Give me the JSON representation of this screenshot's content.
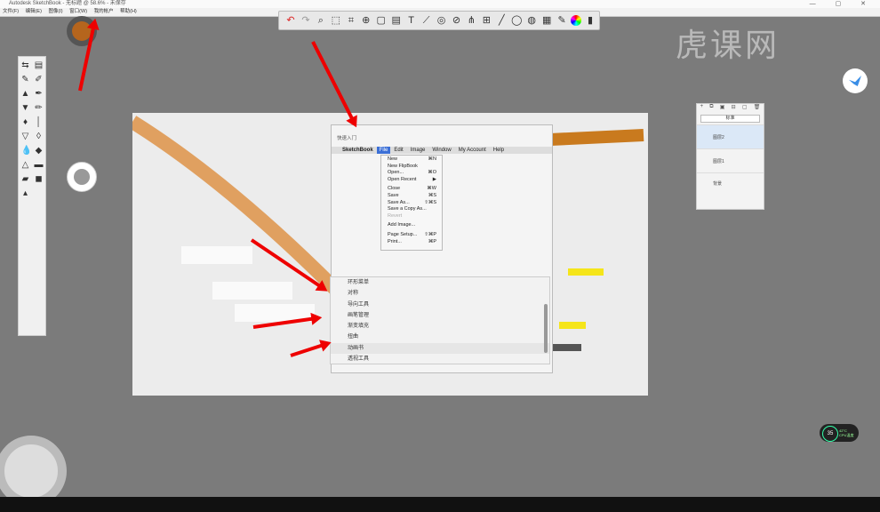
{
  "window": {
    "title": "Autodesk SketchBook - 无标题 @ 58.6% - 未保存",
    "controls": "—  ▢  ✕"
  },
  "menubar": [
    "文件(F)",
    "编辑(E)",
    "图像(I)",
    "窗口(W)",
    "我的帐户",
    "帮助(H)"
  ],
  "watermark": "虎课网",
  "layers": {
    "blend": "标准",
    "items": [
      {
        "name": "图层2",
        "selected": true
      },
      {
        "name": "图层1",
        "selected": false
      }
    ],
    "background": "背景"
  },
  "screenshot_window": {
    "title": "快速入门",
    "mac_menu": {
      "apple": "",
      "app": "SketchBook",
      "file": "File",
      "edit": "Edit",
      "image": "Image",
      "window": "Window",
      "account": "My Account",
      "help": "Help"
    },
    "file_menu": [
      {
        "label": "New",
        "key": "⌘N",
        "disabled": false
      },
      {
        "label": "New FlipBook",
        "key": "",
        "disabled": false
      },
      {
        "label": "Open...",
        "key": "⌘O",
        "disabled": false
      },
      {
        "label": "Open Recent",
        "key": "▶",
        "disabled": false
      },
      {
        "label": "",
        "key": "",
        "sep": true
      },
      {
        "label": "Close",
        "key": "⌘W",
        "disabled": false
      },
      {
        "label": "Save",
        "key": "⌘S",
        "disabled": false
      },
      {
        "label": "Save As...",
        "key": "⇧⌘S",
        "disabled": false
      },
      {
        "label": "Save a Copy As...",
        "key": "",
        "disabled": false
      },
      {
        "label": "Revert",
        "key": "",
        "disabled": true
      },
      {
        "label": "",
        "key": "",
        "sep": true
      },
      {
        "label": "Add Image...",
        "key": "",
        "disabled": false
      },
      {
        "label": "",
        "key": "",
        "sep": true
      },
      {
        "label": "Page Setup...",
        "key": "⇧⌘P",
        "disabled": false
      },
      {
        "label": "Print...",
        "key": "⌘P",
        "disabled": false
      }
    ]
  },
  "dropdown": {
    "items": [
      "环形菜单",
      "对称",
      "导向工具",
      "画笔管理",
      "渐变填充",
      "扭曲",
      "动画书",
      "透视工具"
    ]
  },
  "gauge": {
    "value": "35",
    "unit": "%",
    "temp": "42°C",
    "label": "CPU温度"
  },
  "colors": {
    "accent": "#3b6fd6",
    "arrow": "#e00000",
    "orange_stroke": "#e0a060"
  }
}
